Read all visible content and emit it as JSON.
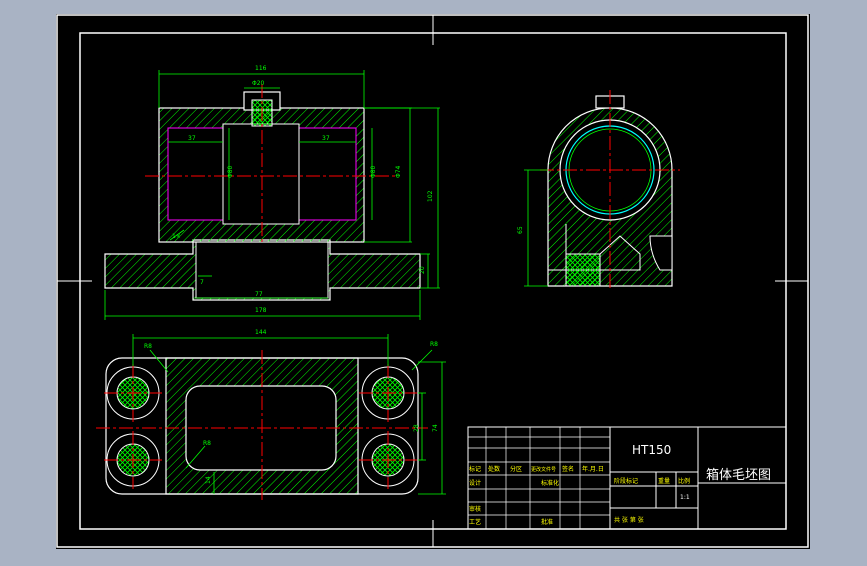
{
  "colors": {
    "app_background": "#a9b3c4",
    "canvas": "#000000",
    "outline": "#ffffff",
    "dimension": "#00ff00",
    "centerline": "#ff0000",
    "hatch": "#00ff00",
    "section_accent": "#ff00ff",
    "bore": "#00ffff",
    "title_text": "#ffffff",
    "table_text": "#ffff00"
  },
  "drawing": {
    "material": "HT150",
    "title": "箱体毛坯图"
  },
  "front_view": {
    "dims": {
      "overall_top": "116",
      "boss_dia": "Φ20",
      "left_depth": "37",
      "right_depth": "37",
      "bore_left": "Φ80",
      "bore_right": "Φ80",
      "outer_dia": "Φ74",
      "height": "102",
      "base_height": "20",
      "chamfer": "1×",
      "groove": "7",
      "slot_width": "77",
      "base_width": "178"
    }
  },
  "side_view": {
    "dims": {
      "center_height": "65"
    }
  },
  "plan_view": {
    "dims": {
      "overall_width": "144",
      "corner_radius_left": "R8",
      "corner_radius_right": "R8",
      "outer_height": "74",
      "inner_height": "28",
      "inner_radius": "R8",
      "edge_offset": "14"
    }
  },
  "title_block": {
    "header_cells": [
      "标记",
      "处数",
      "分区",
      "更改文件号",
      "签名",
      "年.月.日"
    ],
    "rows": [
      "设计",
      "审核",
      "工艺"
    ],
    "std_label": "标准化",
    "approve_label": "批准",
    "stage_label": "阶段标记",
    "weight_label": "重量",
    "scale_label": "比例",
    "scale_value": "1:1",
    "sheets_label": "共  张  第  张"
  }
}
